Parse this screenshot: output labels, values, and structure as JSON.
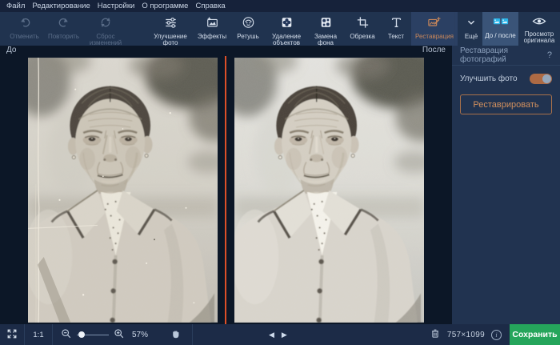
{
  "menu": {
    "items": [
      "Файл",
      "Редактирование",
      "Настройки",
      "О программе",
      "Справка"
    ]
  },
  "toolbar": {
    "history": [
      {
        "label": "Отменить",
        "icon": "undo-icon",
        "disabled": true
      },
      {
        "label": "Повторить",
        "icon": "redo-icon",
        "disabled": true
      },
      {
        "label": "Сброс изменений",
        "icon": "reset-icon",
        "disabled": true
      }
    ],
    "tools": [
      {
        "label": "Улучшение фото",
        "icon": "adjustments-icon"
      },
      {
        "label": "Эффекты",
        "icon": "effects-icon"
      },
      {
        "label": "Ретушь",
        "icon": "retouch-face-icon"
      },
      {
        "label": "Удаление объектов",
        "icon": "object-removal-icon"
      },
      {
        "label": "Замена фона",
        "icon": "background-replace-icon"
      },
      {
        "label": "Обрезка",
        "icon": "crop-icon"
      },
      {
        "label": "Текст",
        "icon": "text-icon"
      },
      {
        "label": "Реставрация",
        "icon": "restoration-icon",
        "active": true
      },
      {
        "label": "Ещё",
        "icon": "chevron-down-icon"
      }
    ],
    "view": [
      {
        "label": "До / после",
        "icon": "before-after-icon",
        "active": true
      },
      {
        "label": "Просмотр оригинала",
        "icon": "eye-icon"
      }
    ]
  },
  "canvas": {
    "before_label": "До",
    "after_label": "После"
  },
  "panel": {
    "title": "Реставрация фотографий",
    "help_label": "?",
    "enhance_label": "Улучшить фото",
    "enhance_on": true,
    "restore_button_label": "Реставрировать"
  },
  "statusbar": {
    "actual_size": "1:1",
    "zoom_level": "57%",
    "prev_arrow": "◀",
    "next_arrow": "▶",
    "dimensions": "757×1099",
    "info_label": "i",
    "save_label": "Сохранить"
  },
  "colors": {
    "accent_orange": "#c9875a",
    "save_green": "#25a55b",
    "divider_red": "#dd4f28",
    "icon_cyan": "#2bb6ea"
  }
}
